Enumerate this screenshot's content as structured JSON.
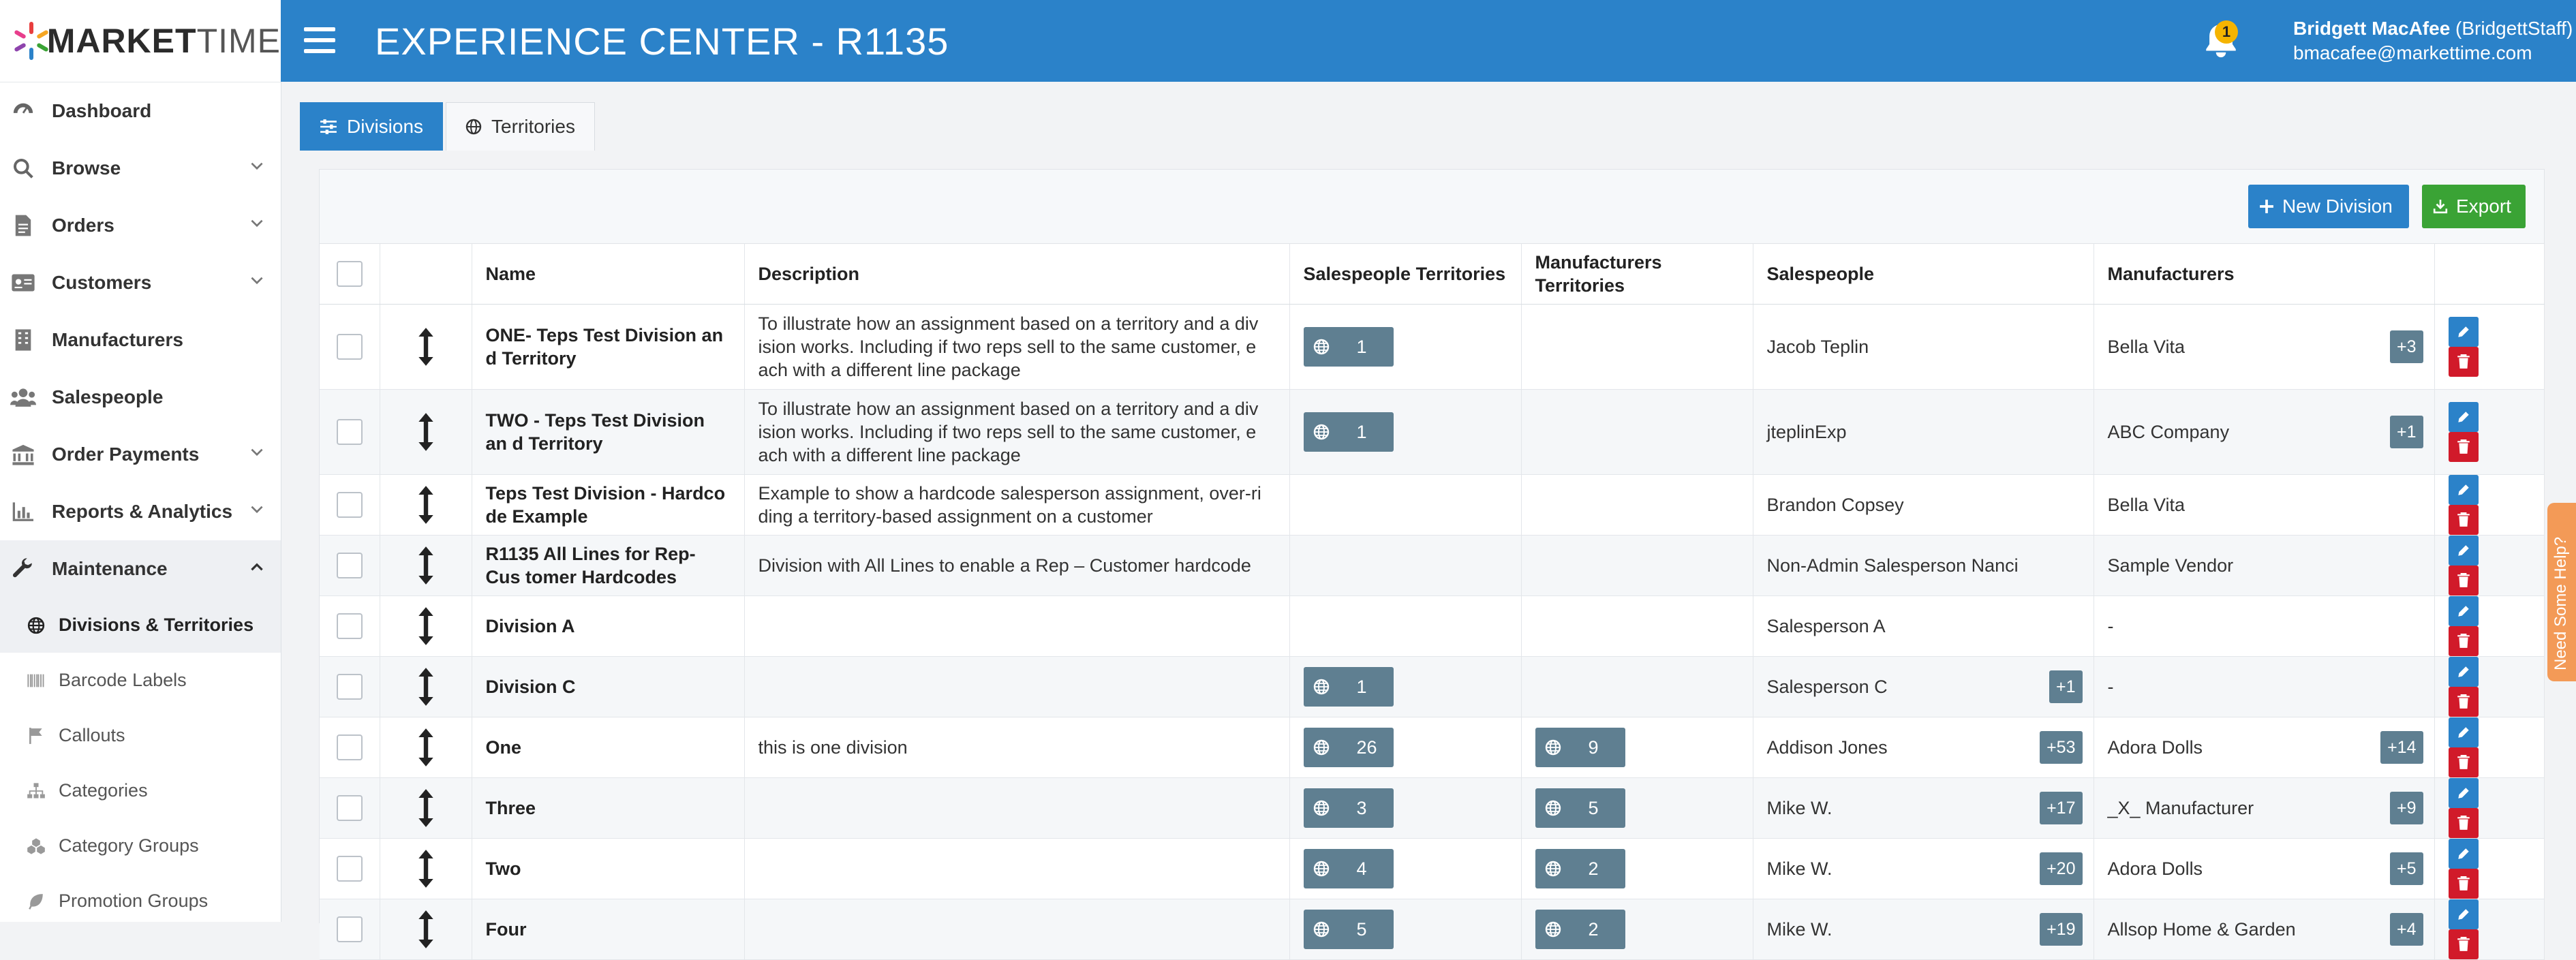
{
  "brand": {
    "logo_bold": "MARKET",
    "logo_light": "TIME"
  },
  "header": {
    "title": "EXPERIENCE CENTER - R1135",
    "notification_count": "1",
    "user_name": "Bridgett MacAfee",
    "user_handle": "(BridgettStaff)",
    "user_email": "bmacafee@markettime.com"
  },
  "sidebar": {
    "items": [
      {
        "label": "Dashboard",
        "icon": "dashboard-icon"
      },
      {
        "label": "Browse",
        "icon": "search-icon"
      },
      {
        "label": "Orders",
        "icon": "document-icon"
      },
      {
        "label": "Customers",
        "icon": "id-card-icon"
      },
      {
        "label": "Manufacturers",
        "icon": "building-icon"
      },
      {
        "label": "Salespeople",
        "icon": "users-icon"
      },
      {
        "label": "Order Payments",
        "icon": "bank-icon"
      },
      {
        "label": "Reports & Analytics",
        "icon": "chart-icon"
      },
      {
        "label": "Maintenance",
        "icon": "wrench-icon"
      }
    ],
    "sub_items": [
      {
        "label": "Divisions & Territories",
        "icon": "globe-icon"
      },
      {
        "label": "Barcode Labels",
        "icon": "barcode-icon"
      },
      {
        "label": "Callouts",
        "icon": "flag-icon"
      },
      {
        "label": "Categories",
        "icon": "sitemap-icon"
      },
      {
        "label": "Category Groups",
        "icon": "cubes-icon"
      },
      {
        "label": "Promotion Groups",
        "icon": "leaf-icon"
      }
    ]
  },
  "tabs": [
    {
      "label": "Divisions"
    },
    {
      "label": "Territories"
    }
  ],
  "toolbar": {
    "new_label": "New Division",
    "export_label": "Export"
  },
  "table": {
    "headers": [
      "Name",
      "Description",
      "Salespeople Territories",
      "Manufacturers Territories",
      "Salespeople",
      "Manufacturers"
    ],
    "rows": [
      {
        "name": "ONE- Teps Test Division an d Territory",
        "description": "To illustrate how an assignment based on a territory and a div ision works. Including if two reps sell to the same customer, e ach with a different line package",
        "sp_terr": "1",
        "mf_terr": "",
        "salespeople": "Jacob Teplin",
        "sp_more": "",
        "manufacturers": "Bella Vita",
        "mf_more": "+3"
      },
      {
        "name": "TWO - Teps Test Division an d Territory",
        "description": "To illustrate how an assignment based on a territory and a div ision works. Including if two reps sell to the same customer, e ach with a different line package",
        "sp_terr": "1",
        "mf_terr": "",
        "salespeople": "jteplinExp",
        "sp_more": "",
        "manufacturers": "ABC Company",
        "mf_more": "+1"
      },
      {
        "name": "Teps Test Division - Hardco de Example",
        "description": "Example to show a hardcode salesperson assignment, over-ri ding a territory-based assignment on a customer",
        "sp_terr": "",
        "mf_terr": "",
        "salespeople": "Brandon Copsey",
        "sp_more": "",
        "manufacturers": "Bella Vita",
        "mf_more": ""
      },
      {
        "name": "R1135 All Lines for Rep-Cus tomer Hardcodes",
        "description": "Division with All Lines to enable a Rep – Customer hardcode",
        "sp_terr": "",
        "mf_terr": "",
        "salespeople": "Non-Admin Salesperson Nanci",
        "sp_more": "",
        "manufacturers": "Sample Vendor",
        "mf_more": ""
      },
      {
        "name": "Division A",
        "description": "",
        "sp_terr": "",
        "mf_terr": "",
        "salespeople": "Salesperson A",
        "sp_more": "",
        "manufacturers": "-",
        "mf_more": ""
      },
      {
        "name": "Division C",
        "description": "",
        "sp_terr": "1",
        "mf_terr": "",
        "salespeople": "Salesperson C",
        "sp_more": "+1",
        "manufacturers": "-",
        "mf_more": ""
      },
      {
        "name": "One",
        "description": "this is one division",
        "sp_terr": "26",
        "mf_terr": "9",
        "salespeople": "Addison Jones",
        "sp_more": "+53",
        "manufacturers": "Adora Dolls",
        "mf_more": "+14"
      },
      {
        "name": "Three",
        "description": "",
        "sp_terr": "3",
        "mf_terr": "5",
        "salespeople": "Mike W.",
        "sp_more": "+17",
        "manufacturers": "_X_ Manufacturer",
        "mf_more": "+9"
      },
      {
        "name": "Two",
        "description": "",
        "sp_terr": "4",
        "mf_terr": "2",
        "salespeople": "Mike W.",
        "sp_more": "+20",
        "manufacturers": "Adora Dolls",
        "mf_more": "+5"
      },
      {
        "name": "Four",
        "description": "",
        "sp_terr": "5",
        "mf_terr": "2",
        "salespeople": "Mike W.",
        "sp_more": "+19",
        "manufacturers": "Allsop Home & Garden",
        "mf_more": "+4"
      }
    ]
  },
  "help": {
    "label": "Need Some Help?"
  },
  "colors": {
    "primary": "#2b82c9",
    "success": "#3aa335",
    "danger": "#d11a2a",
    "pill": "#5f7f91",
    "help": "#f39a57"
  }
}
